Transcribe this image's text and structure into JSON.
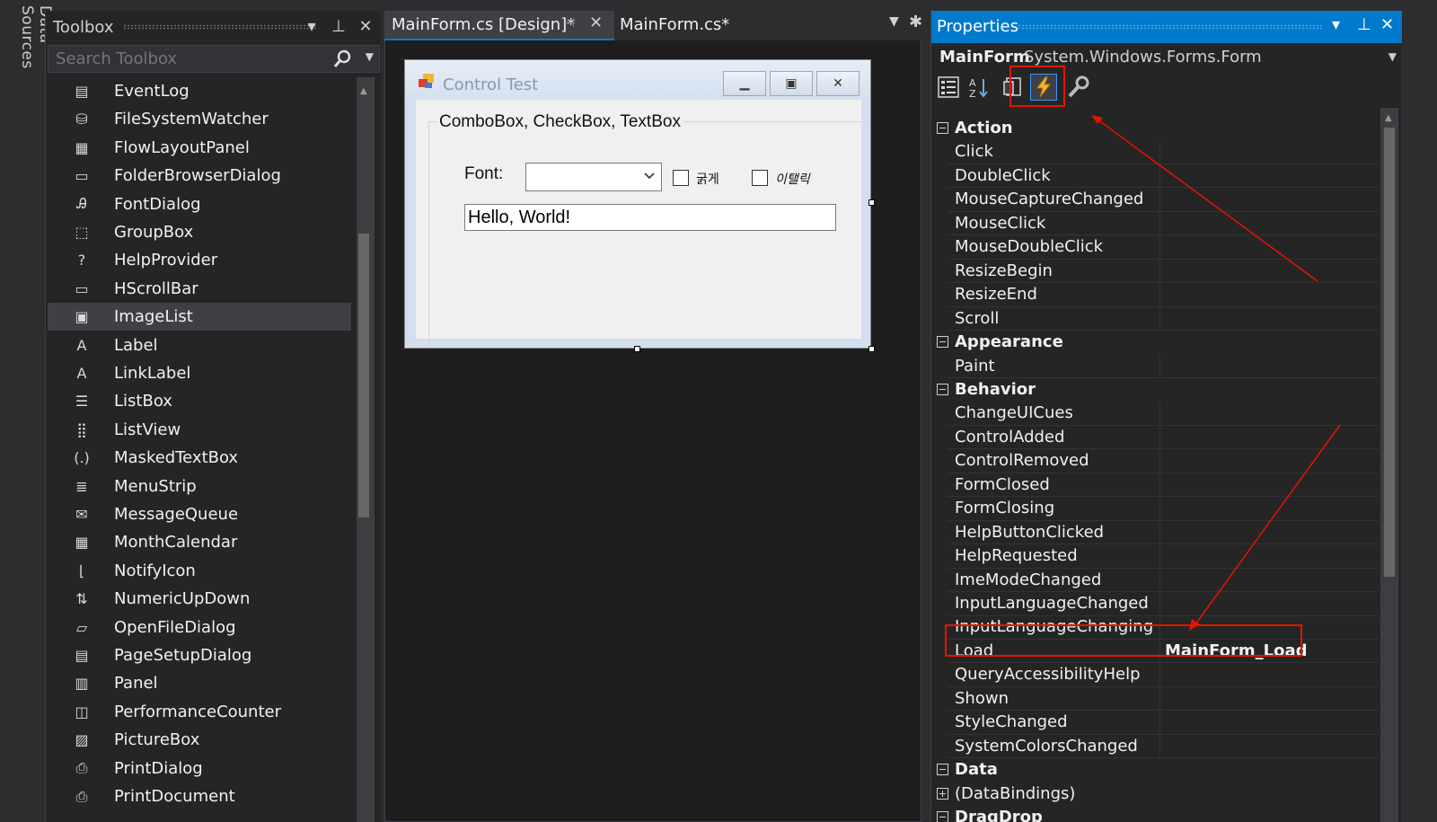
{
  "data_sources_tab": "Data Sources",
  "toolbox": {
    "title": "Toolbox",
    "search_placeholder": "Search Toolbox",
    "items": [
      {
        "label": "EventLog",
        "icon": "eventlog-icon"
      },
      {
        "label": "FileSystemWatcher",
        "icon": "filesystemwatcher-icon"
      },
      {
        "label": "FlowLayoutPanel",
        "icon": "flowlayoutpanel-icon"
      },
      {
        "label": "FolderBrowserDialog",
        "icon": "folderbrowserdialog-icon"
      },
      {
        "label": "FontDialog",
        "icon": "fontdialog-icon"
      },
      {
        "label": "GroupBox",
        "icon": "groupbox-icon"
      },
      {
        "label": "HelpProvider",
        "icon": "helpprovider-icon"
      },
      {
        "label": "HScrollBar",
        "icon": "hscrollbar-icon"
      },
      {
        "label": "ImageList",
        "icon": "imagelist-icon",
        "selected": true
      },
      {
        "label": "Label",
        "icon": "label-icon"
      },
      {
        "label": "LinkLabel",
        "icon": "linklabel-icon"
      },
      {
        "label": "ListBox",
        "icon": "listbox-icon"
      },
      {
        "label": "ListView",
        "icon": "listview-icon"
      },
      {
        "label": "MaskedTextBox",
        "icon": "maskedtextbox-icon"
      },
      {
        "label": "MenuStrip",
        "icon": "menustrip-icon"
      },
      {
        "label": "MessageQueue",
        "icon": "messagequeue-icon"
      },
      {
        "label": "MonthCalendar",
        "icon": "monthcalendar-icon"
      },
      {
        "label": "NotifyIcon",
        "icon": "notifyicon-icon"
      },
      {
        "label": "NumericUpDown",
        "icon": "numericupdown-icon"
      },
      {
        "label": "OpenFileDialog",
        "icon": "openfiledialog-icon"
      },
      {
        "label": "PageSetupDialog",
        "icon": "pagesetupdialog-icon"
      },
      {
        "label": "Panel",
        "icon": "panel-icon"
      },
      {
        "label": "PerformanceCounter",
        "icon": "performancecounter-icon"
      },
      {
        "label": "PictureBox",
        "icon": "picturebox-icon"
      },
      {
        "label": "PrintDialog",
        "icon": "printdialog-icon"
      },
      {
        "label": "PrintDocument",
        "icon": "printdocument-icon"
      }
    ]
  },
  "tabs": [
    {
      "label": "MainForm.cs [Design]*",
      "active": true
    },
    {
      "label": "MainForm.cs*",
      "active": false
    }
  ],
  "designer": {
    "form_title": "Control Test",
    "groupbox_title": "ComboBox, CheckBox, TextBox",
    "font_label": "Font:",
    "combo_value": "",
    "checkbox_bold": "굵게",
    "checkbox_italic": "이탤릭",
    "textbox_value": "Hello, World!"
  },
  "properties": {
    "title": "Properties",
    "object_name": "MainForm",
    "object_type": "System.Windows.Forms.Form",
    "rows": [
      {
        "type": "cat",
        "name": "Action"
      },
      {
        "name": "Click"
      },
      {
        "name": "DoubleClick"
      },
      {
        "name": "MouseCaptureChanged"
      },
      {
        "name": "MouseClick"
      },
      {
        "name": "MouseDoubleClick"
      },
      {
        "name": "ResizeBegin"
      },
      {
        "name": "ResizeEnd"
      },
      {
        "name": "Scroll"
      },
      {
        "type": "cat",
        "name": "Appearance"
      },
      {
        "name": "Paint"
      },
      {
        "type": "cat",
        "name": "Behavior"
      },
      {
        "name": "ChangeUICues"
      },
      {
        "name": "ControlAdded"
      },
      {
        "name": "ControlRemoved"
      },
      {
        "name": "FormClosed"
      },
      {
        "name": "FormClosing"
      },
      {
        "name": "HelpButtonClicked"
      },
      {
        "name": "HelpRequested"
      },
      {
        "name": "ImeModeChanged"
      },
      {
        "name": "InputLanguageChanged"
      },
      {
        "name": "InputLanguageChanging"
      },
      {
        "name": "Load",
        "value": "MainForm_Load"
      },
      {
        "name": "QueryAccessibilityHelp"
      },
      {
        "name": "Shown"
      },
      {
        "name": "StyleChanged"
      },
      {
        "name": "SystemColorsChanged"
      },
      {
        "type": "cat",
        "name": "Data"
      },
      {
        "type": "exp",
        "name": "(DataBindings)"
      },
      {
        "type": "cat",
        "name": "DragDrop"
      }
    ]
  },
  "colors": {
    "accent": "#007acc",
    "highlight": "#e51400",
    "panel_bg": "#252526",
    "chrome_bg": "#2d2d30"
  }
}
